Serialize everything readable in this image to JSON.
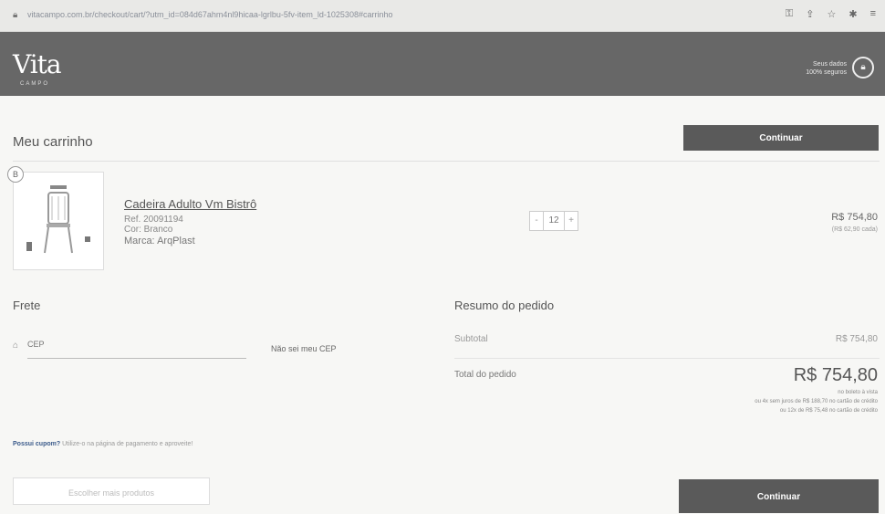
{
  "browser": {
    "url": "vitacampo.com.br/checkout/cart/?utm_id=084d67ahm4nl9hicaa-lgrlbu-5fv-item_ld-1025308#carrinho",
    "lock_icon": "lock-icon"
  },
  "header": {
    "logo": "Vita",
    "logo_sub": "CAMPO",
    "secure_line1": "Seus dados",
    "secure_line2": "100% seguros",
    "secure_icon": "padlock-icon"
  },
  "cart": {
    "title": "Meu carrinho",
    "continue_top": "Continuar",
    "badge": "B"
  },
  "product": {
    "name": "Cadeira Adulto Vm Bistrô",
    "ref": "Ref. 20091194",
    "color": "Cor: Branco",
    "brand": "Marca: ArqPlast",
    "qty_minus": "-",
    "qty_value": "12",
    "qty_plus": "+",
    "price": "R$ 754,80",
    "unit_price": "(R$ 62,90 cada)"
  },
  "frete": {
    "title": "Frete",
    "cep_placeholder": "CEP",
    "cep_link": "Não sei meu CEP"
  },
  "summary": {
    "title": "Resumo do pedido",
    "subtotal_label": "Subtotal",
    "subtotal_value": "R$ 754,80",
    "total_label": "Total do pedido",
    "total_value": "R$ 754,80",
    "pay_line1": "no boleto à vista",
    "pay_line2": "ou 4x sem juros de R$ 188,70 no cartão de crédito",
    "pay_line3": "ou 12x de R$ 75,48 no cartão de crédito"
  },
  "coupon": {
    "lead": "Possui cupom?",
    "text": " Utilize-o na página de pagamento e aproveite!"
  },
  "footer": {
    "more_products": "Escolher mais produtos",
    "continue_bottom": "Continuar"
  }
}
